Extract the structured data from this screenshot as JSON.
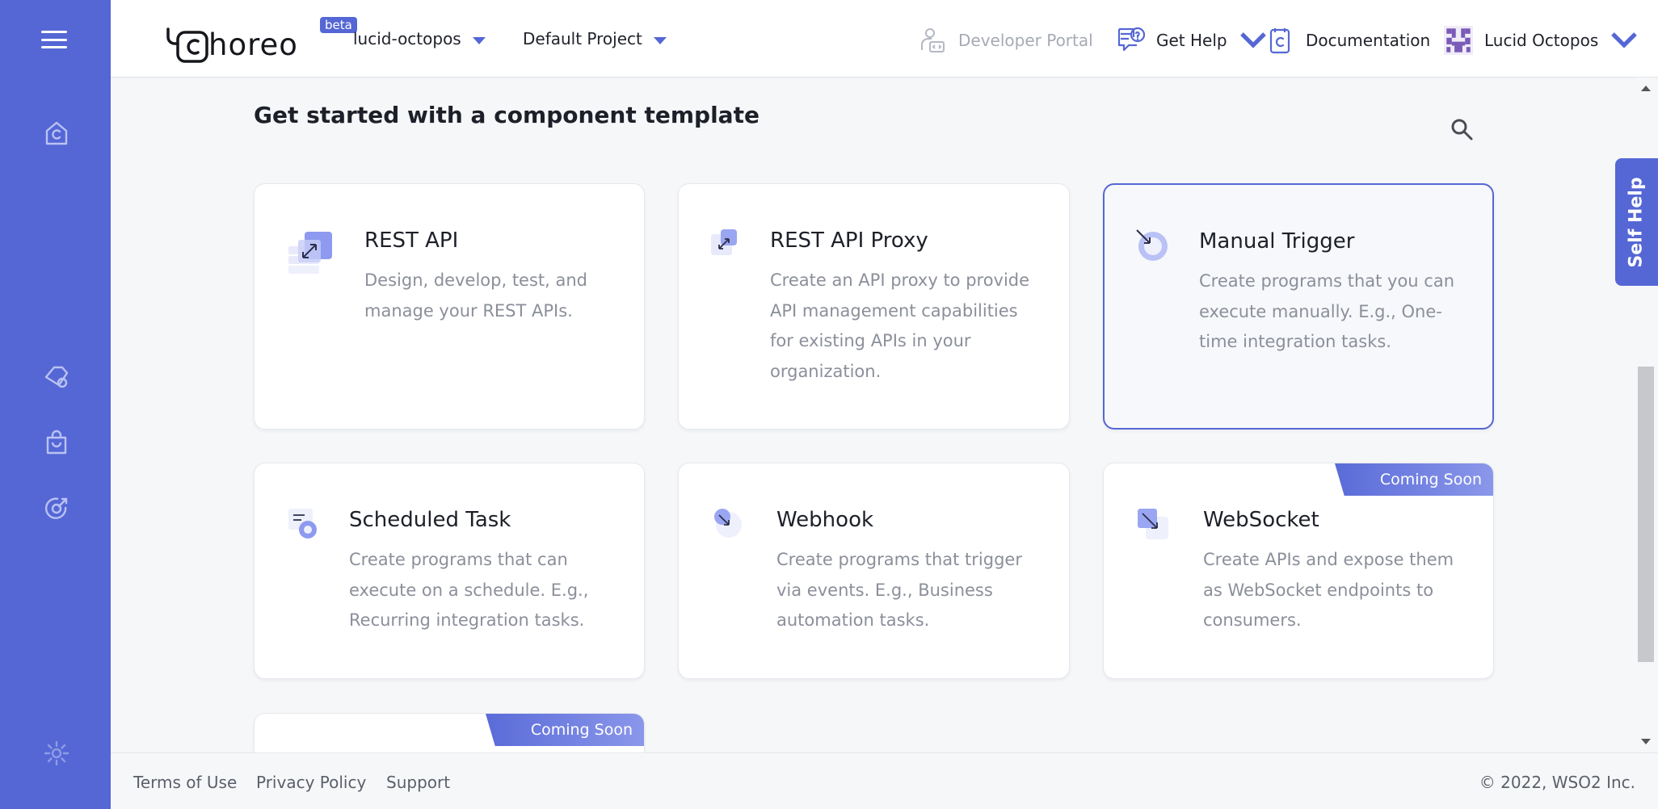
{
  "header": {
    "logo_text": "horeo",
    "beta_label": "beta",
    "org_selector": "lucid-octopos",
    "project_selector": "Default Project",
    "developer_portal": "Developer Portal",
    "get_help": "Get Help",
    "documentation": "Documentation",
    "user_name": "Lucid Octopos"
  },
  "main": {
    "title": "Get started with a component template",
    "cards": [
      {
        "title": "REST API",
        "desc": "Design, develop, test, and manage your REST APIs.",
        "icon": "rest-api-icon"
      },
      {
        "title": "REST API Proxy",
        "desc": "Create an API proxy to provide API management capabilities for existing APIs in your organization.",
        "icon": "rest-api-proxy-icon"
      },
      {
        "title": "Manual Trigger",
        "desc": "Create programs that you can execute manually. E.g., One-time integration tasks.",
        "icon": "manual-trigger-icon",
        "selected": true
      },
      {
        "title": "Scheduled Task",
        "desc": "Create programs that can execute on a schedule. E.g., Recurring integration tasks.",
        "icon": "scheduled-task-icon"
      },
      {
        "title": "Webhook",
        "desc": "Create programs that trigger via events. E.g., Business automation tasks.",
        "icon": "webhook-icon"
      },
      {
        "title": "WebSocket",
        "desc": "Create APIs and expose them as WebSocket endpoints to consumers.",
        "icon": "websocket-icon",
        "badge": "Coming Soon"
      }
    ],
    "partial_card_badge": "Coming Soon"
  },
  "self_help": "Self Help",
  "footer": {
    "terms": "Terms of Use",
    "privacy": "Privacy Policy",
    "support": "Support",
    "copyright": "©  2022, WSO2 Inc."
  },
  "colors": {
    "brand": "#5567d5",
    "background": "#f6f7f9"
  }
}
